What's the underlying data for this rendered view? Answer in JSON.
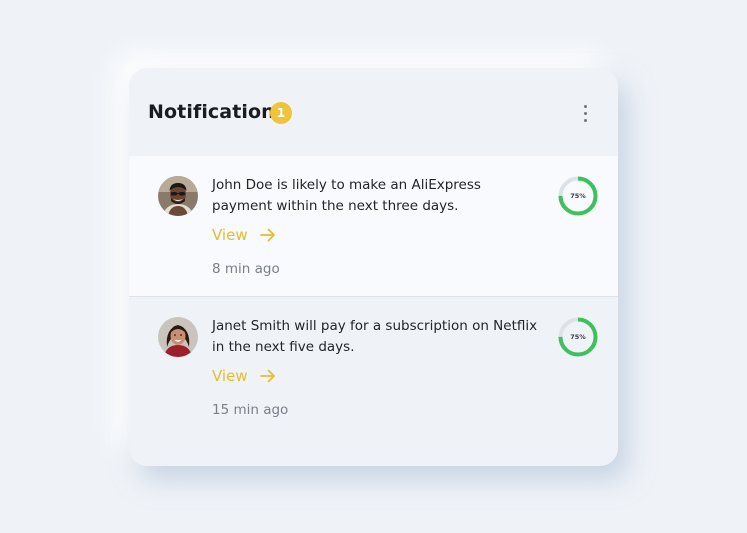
{
  "panel": {
    "title": "Notifications",
    "badge_count": "1",
    "menu_icon": "more-vertical-icon"
  },
  "colors": {
    "accent": "#efc43a",
    "link": "#e6bd2c",
    "progress": "#3dc15a",
    "progress_track": "#dde2e8"
  },
  "notifications": [
    {
      "avatar": "avatar-john-doe",
      "message": "John Doe is likely to make an AliExpress payment within the next three days.",
      "link_label": "View",
      "link_icon": "arrow-right-icon",
      "time": "8 min ago",
      "progress_label": "75%",
      "progress_value": 0.75
    },
    {
      "avatar": "avatar-janet-smith",
      "message": "Janet Smith will pay for a subscription on Netflix in the next five days.",
      "link_label": "View",
      "link_icon": "arrow-right-icon",
      "time": "15 min ago",
      "progress_label": "75%",
      "progress_value": 0.75
    }
  ]
}
